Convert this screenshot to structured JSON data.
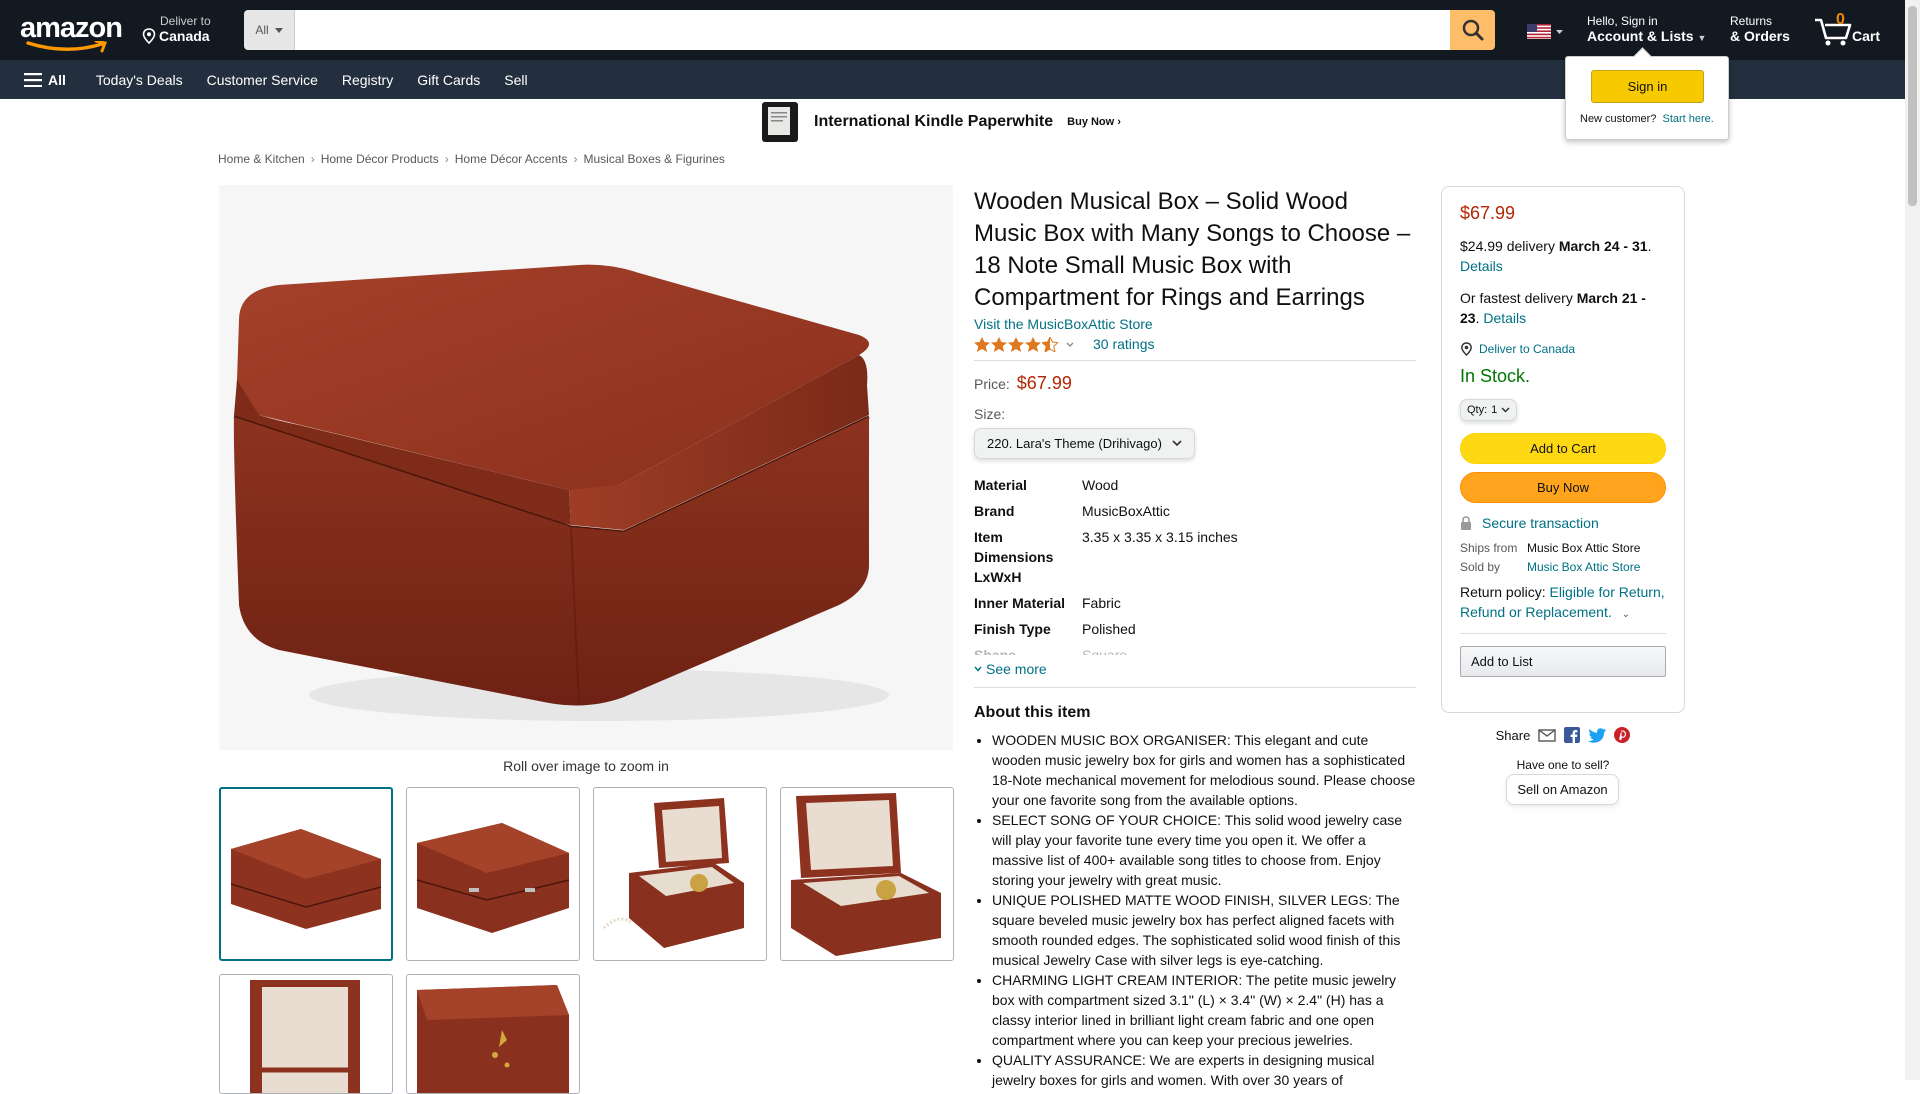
{
  "nav": {
    "logo": "amazon",
    "deliver_line1": "Deliver to",
    "deliver_line2": "Canada",
    "search_category": "All",
    "search_placeholder": "",
    "account_line1": "Hello, Sign in",
    "account_line2": "Account & Lists",
    "orders_line1": "Returns",
    "orders_line2": "& Orders",
    "cart_count": "0",
    "cart_label": "Cart"
  },
  "subnav": {
    "all": "All",
    "items": [
      "Today's Deals",
      "Customer Service",
      "Registry",
      "Gift Cards",
      "Sell"
    ]
  },
  "flyout": {
    "signin": "Sign in",
    "new_customer": "New customer?",
    "start_here": "Start here."
  },
  "banner": {
    "title": "International Kindle Paperwhite",
    "cta": "Buy Now ›"
  },
  "breadcrumb": [
    "Home & Kitchen",
    "Home Décor Products",
    "Home Décor Accents",
    "Musical Boxes & Figurines"
  ],
  "images": {
    "roll_text": "Roll over image to zoom in"
  },
  "product": {
    "title": "Wooden Musical Box – Solid Wood Music Box with Many Songs to Choose – 18 Note Small Music Box with Compartment for Rings and Earrings",
    "store": "Visit the MusicBoxAttic Store",
    "rating": 4.5,
    "ratings_count": "30 ratings",
    "price_label": "Price:",
    "price": "$67.99",
    "size_label": "Size:",
    "size_value": "220. Lara's Theme (Drihivago)",
    "specs": [
      {
        "k": "Material",
        "v": "Wood"
      },
      {
        "k": "Brand",
        "v": "MusicBoxAttic"
      },
      {
        "k": "Item Dimensions LxWxH",
        "v": "3.35 x 3.35 x 3.15 inches"
      },
      {
        "k": "Inner Material",
        "v": "Fabric"
      },
      {
        "k": "Finish Type",
        "v": "Polished"
      },
      {
        "k": "Shape",
        "v": "Square"
      }
    ],
    "see_more": "See more",
    "about_heading": "About this item",
    "bullets": [
      "WOODEN MUSIC BOX ORGANISER: This elegant and cute wooden music jewelry box for girls and women has a sophisticated 18-Note mechanical movement for melodious sound. Please choose your one favorite song from the available options.",
      "SELECT SONG OF YOUR CHOICE: This solid wood jewelry case will play your favorite tune every time you open it. We offer a massive list of 400+ available song titles to choose from. Enjoy storing your jewelry with great music.",
      "UNIQUE POLISHED MATTE WOOD FINISH, SILVER LEGS: The square beveled music jewelry box has perfect aligned facets with smooth rounded edges. The sophisticated solid wood finish of this musical Jewelry Case with silver legs is eye-catching.",
      "CHARMING LIGHT CREAM INTERIOR: The petite music jewelry box with compartment sized 3.1\" (L) × 3.4\" (W) × 2.4\" (H) has a classy interior lined in brilliant light cream fabric and one open compartment where you can keep your precious jewelries.",
      "QUALITY ASSURANCE: We are experts in designing musical jewelry boxes for girls and women. With over 30 years of"
    ]
  },
  "buybox": {
    "price": "$67.99",
    "delivery_prefix": "$24.99 delivery",
    "delivery_date": "March 24 - 31",
    "details": "Details",
    "fastest_prefix": "Or fastest delivery",
    "fastest_date": "March 21 - 23",
    "deliver_to": "Deliver to Canada",
    "stock": "In Stock.",
    "qty_label": "Qty:",
    "qty_value": "1",
    "add_to_cart": "Add to Cart",
    "buy_now": "Buy Now",
    "secure": "Secure transaction",
    "ships_from_label": "Ships from",
    "ships_from": "Music Box Attic Store",
    "sold_by_label": "Sold by",
    "sold_by": "Music Box Attic Store",
    "return_label": "Return policy:",
    "return_link": "Eligible for Return, Refund or Replacement.",
    "add_to_list": "Add to List"
  },
  "share": {
    "label": "Share",
    "have_one": "Have one to sell?",
    "sell_on": "Sell on Amazon"
  },
  "colors": {
    "nav_bg": "#131921",
    "subnav_bg": "#232f3e",
    "price": "#b12704",
    "link": "#007185",
    "stock": "#007600",
    "cart_btn": "#ffd814",
    "buy_btn": "#ffa41c"
  }
}
